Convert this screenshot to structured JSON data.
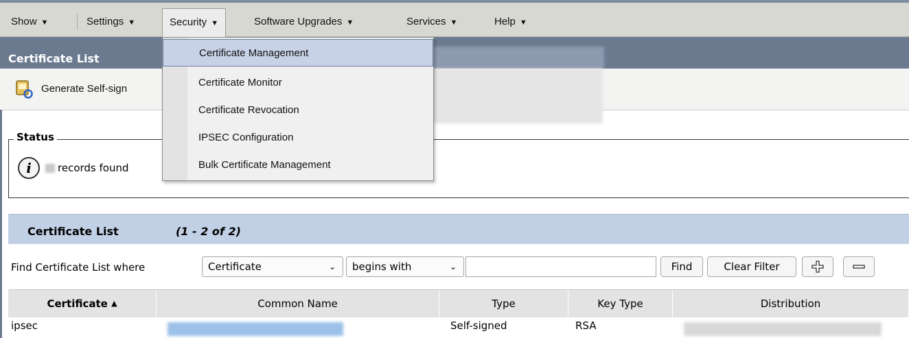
{
  "menubar": {
    "items": [
      {
        "label": "Show",
        "arrow": "▼"
      },
      {
        "label": "Settings",
        "arrow": "▼"
      },
      {
        "label": "Security",
        "arrow": "▼"
      },
      {
        "label": "Software Upgrades",
        "arrow": "▼"
      },
      {
        "label": "Services",
        "arrow": "▼"
      },
      {
        "label": "Help",
        "arrow": "▼"
      }
    ],
    "active": "Security"
  },
  "security_menu": {
    "items": [
      "Certificate Management",
      "Certificate Monitor",
      "Certificate Revocation",
      "IPSEC Configuration",
      "Bulk Certificate Management"
    ],
    "highlighted": "Certificate Management"
  },
  "titlebar": {
    "title": "Certificate List"
  },
  "toolbar": {
    "generate_label": "Generate Self-sign",
    "icon": "certificate-refresh-icon"
  },
  "status": {
    "legend": "Status",
    "message": "records found",
    "icon": "info-icon"
  },
  "list": {
    "title": "Certificate List",
    "range": "(1 - 2 of 2)",
    "find_label": "Find Certificate List where",
    "field_select": "Certificate",
    "operator_select": "begins with",
    "search_value": "",
    "find_button": "Find",
    "clear_button": "Clear Filter",
    "add_icon": "plus-icon",
    "remove_icon": "minus-icon"
  },
  "table": {
    "columns": [
      "Certificate",
      "Common Name",
      "Type",
      "Key Type",
      "Distribution"
    ],
    "sort_indicator": "▲",
    "rows": [
      {
        "certificate": "ipsec",
        "type": "Self-signed",
        "key_type": "RSA"
      }
    ]
  },
  "colors": {
    "menubar": "#d8d8d2",
    "titlebar": "#6c7a90",
    "list_header": "#c2d0e6",
    "menu_highlight": "#c8d2e6"
  }
}
